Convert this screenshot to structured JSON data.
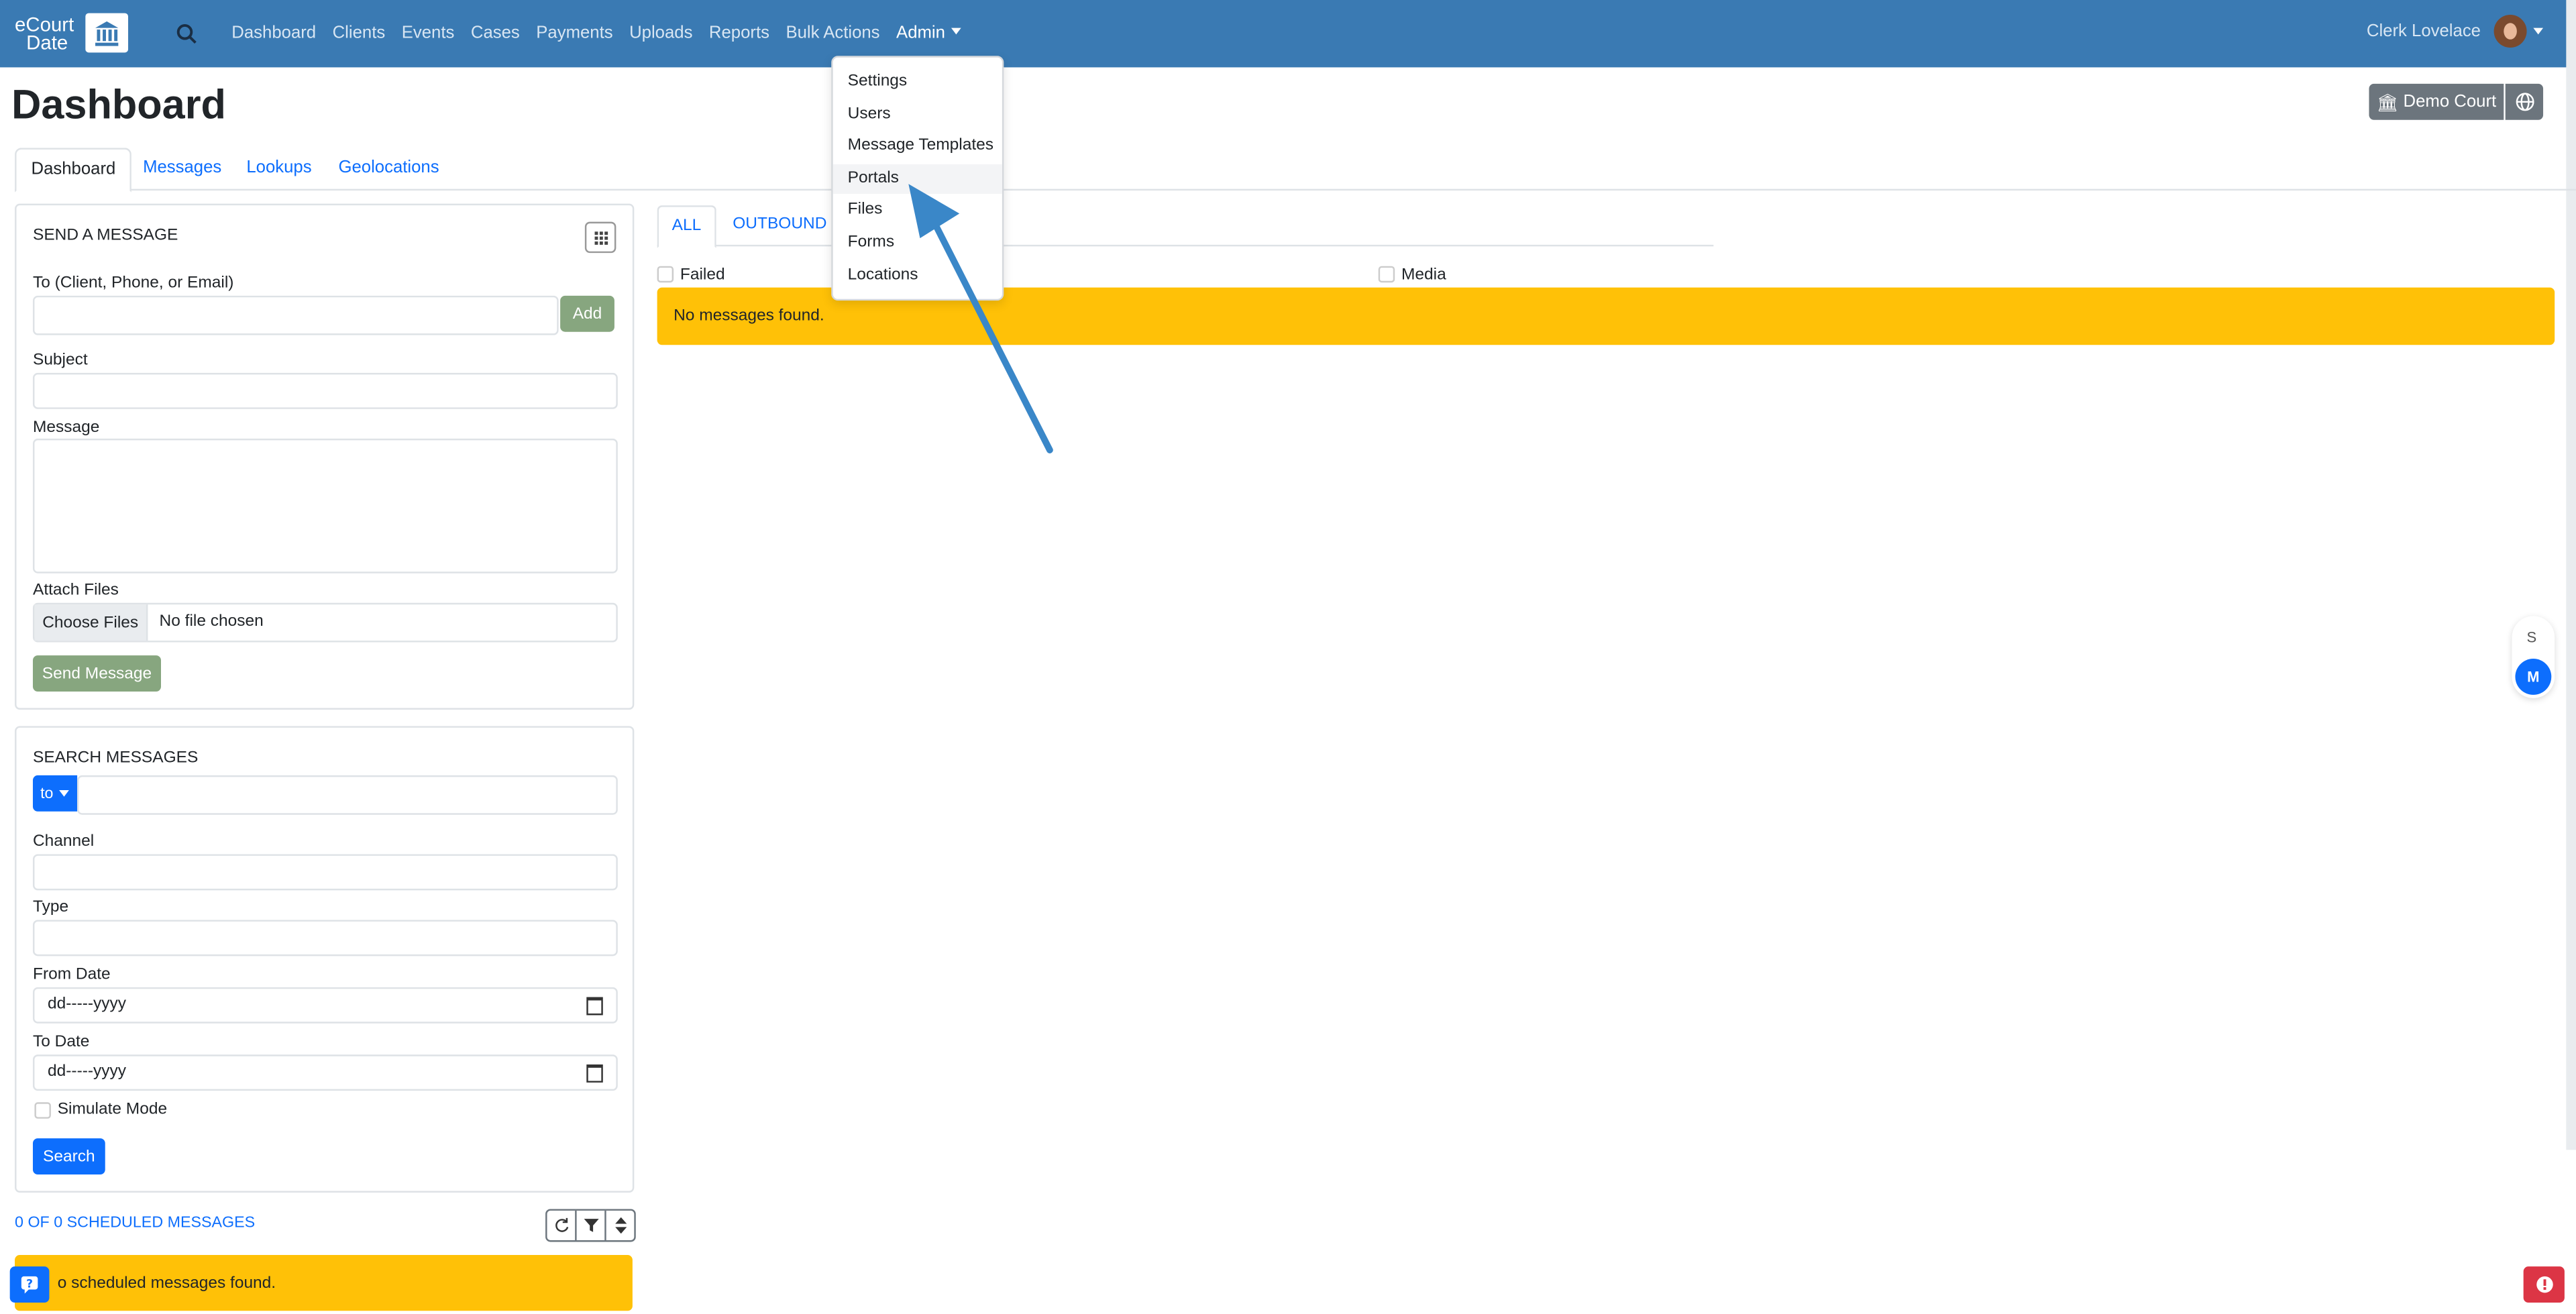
{
  "colors": {
    "navbar": "#3a7ab3",
    "primary": "#0d6efd",
    "warning": "#ffc107",
    "success_muted": "#87a67f",
    "danger": "#dc3545",
    "arrow": "#3a87c8"
  },
  "brand": {
    "line1": "eCourt",
    "line2": "Date",
    "icon": "courthouse-icon"
  },
  "nav": {
    "items": [
      "Dashboard",
      "Clients",
      "Events",
      "Cases",
      "Payments",
      "Uploads",
      "Reports",
      "Bulk Actions"
    ],
    "admin_label": "Admin",
    "user_name": "Clerk Lovelace"
  },
  "admin_menu": [
    "Settings",
    "Users",
    "Message Templates",
    "Portals",
    "Files",
    "Forms",
    "Locations"
  ],
  "page": {
    "title": "Dashboard",
    "court_button": "Demo Court"
  },
  "tabs": [
    "Dashboard",
    "Messages",
    "Lookups",
    "Geolocations"
  ],
  "send_message": {
    "title": "SEND A MESSAGE",
    "to_label": "To (Client, Phone, or Email)",
    "add_label": "Add",
    "subject_label": "Subject",
    "message_label": "Message",
    "attach_label": "Attach Files",
    "choose_files": "Choose Files",
    "no_file": "No file chosen",
    "send_label": "Send Message"
  },
  "search_messages": {
    "title": "SEARCH MESSAGES",
    "to_button": "to",
    "channel_label": "Channel",
    "type_label": "Type",
    "from_label": "From Date",
    "to_date_label": "To Date",
    "date_placeholder": "dd-----yyyy",
    "simulate_label": "Simulate Mode",
    "search_label": "Search"
  },
  "scheduled": {
    "link": "0 OF 0 SCHEDULED MESSAGES",
    "empty": "o scheduled messages found."
  },
  "messages": {
    "tabs": [
      "ALL",
      "OUTBOUND"
    ],
    "filter_failed": "Failed",
    "filter_media": "Media",
    "empty": "No messages found."
  },
  "floating": {
    "s": "S",
    "m": "M"
  }
}
